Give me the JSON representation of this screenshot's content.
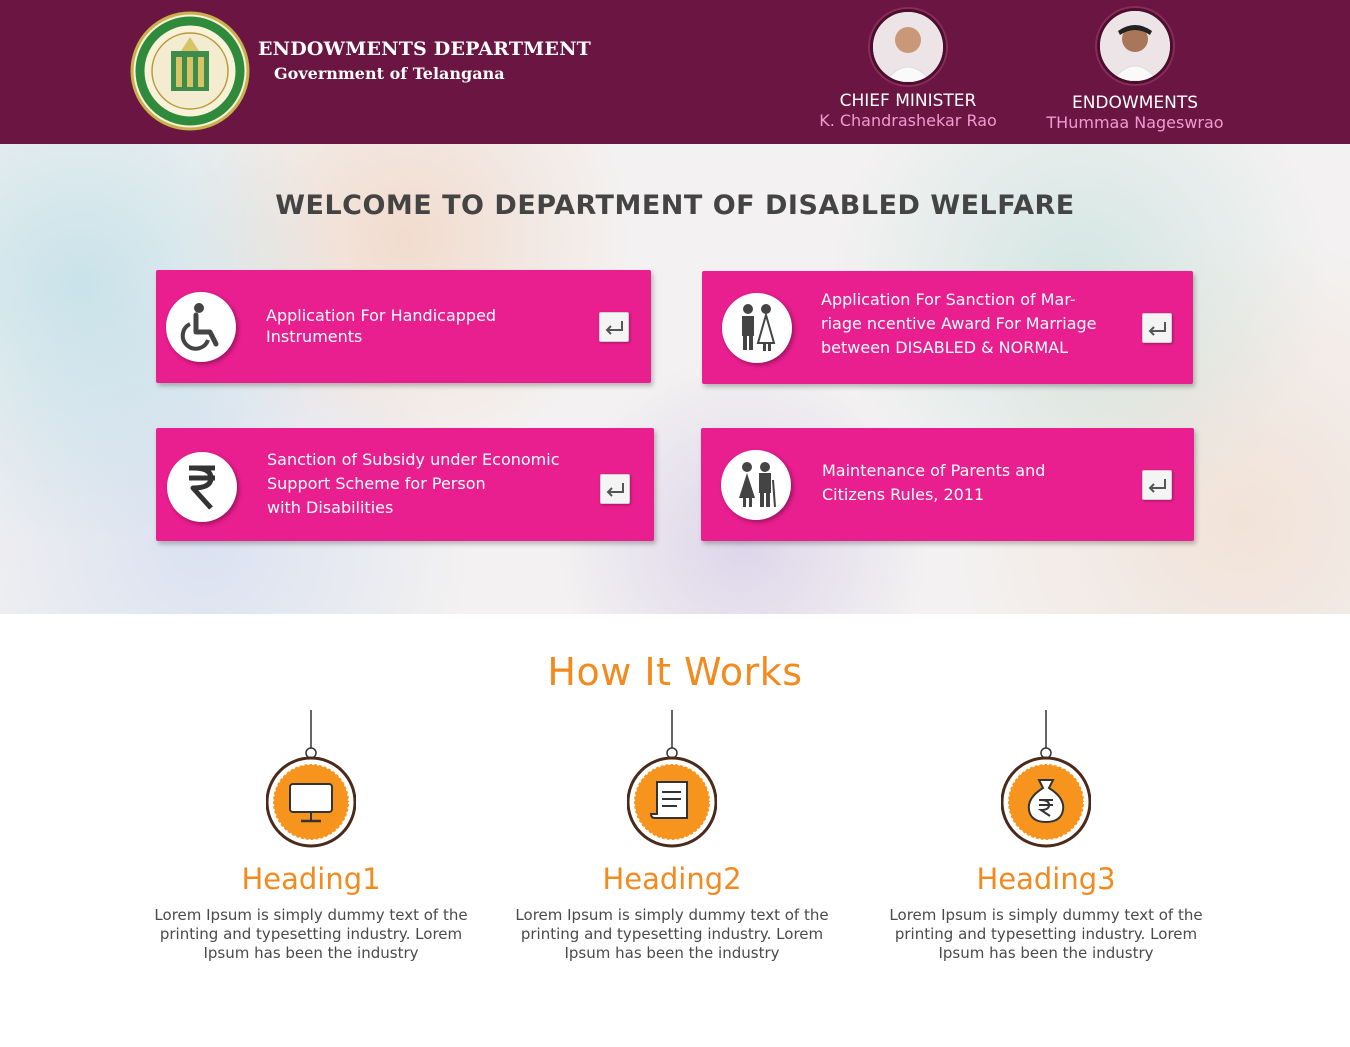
{
  "header": {
    "dept_title": "ENDOWMENTS DEPARTMENT",
    "dept_subtitle": "Government of Telangana",
    "officials": [
      {
        "role": "CHIEF MINISTER",
        "name": "K. Chandrashekar Rao"
      },
      {
        "role": "ENDOWMENTS",
        "name": "THummaa Nageswrao"
      }
    ]
  },
  "hero": {
    "title": "WELCOME TO DEPARTMENT OF DISABLED WELFARE",
    "cards": [
      {
        "lines": [
          "Application For Handicapped",
          "Instruments"
        ],
        "icon": "wheelchair-icon"
      },
      {
        "lines": [
          "Application For Sanction of Mar-",
          "riage ncentive Award For Marriage",
          "between DISABLED & NORMAL"
        ],
        "icon": "couple-icon"
      },
      {
        "lines": [
          "Sanction of Subsidy under Economic",
          "Support Scheme for Person",
          "with Disabilities"
        ],
        "icon": "rupee-icon"
      },
      {
        "lines": [
          "Maintenance of Parents and",
          "Citizens Rules, 2011"
        ],
        "icon": "elderly-couple-icon"
      }
    ]
  },
  "how": {
    "title": "How It Works",
    "steps": [
      {
        "heading": "Heading1",
        "lines": [
          "Lorem Ipsum is simply dummy text of the",
          "printing and typesetting industry. Lorem",
          "Ipsum has been the industry"
        ],
        "icon": "monitor-icon"
      },
      {
        "heading": "Heading2",
        "lines": [
          "Lorem Ipsum is simply dummy text of the",
          "printing and typesetting industry. Lorem",
          "Ipsum has been the industry"
        ],
        "icon": "scroll-icon"
      },
      {
        "heading": "Heading3",
        "lines": [
          "Lorem Ipsum is simply dummy text of the",
          "printing and typesetting industry. Lorem",
          "Ipsum has been the industry"
        ],
        "icon": "money-bag-icon"
      }
    ]
  },
  "colors": {
    "header_bg": "#6b1543",
    "card_bg": "#e91e8f",
    "accent_orange": "#f28a1e",
    "official_name": "#f09ad0"
  }
}
